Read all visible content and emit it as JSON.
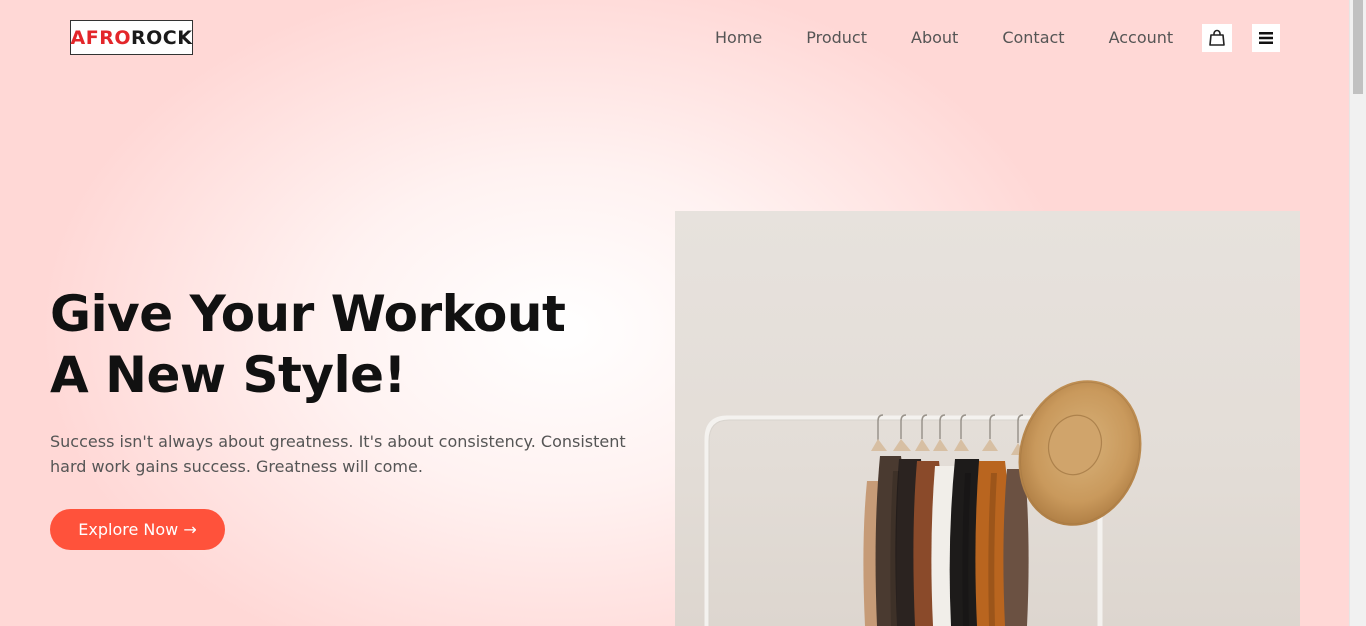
{
  "brand": {
    "logo_part1": "AFRO",
    "logo_part2": "ROCK",
    "accent_red": "#e3262a"
  },
  "nav": {
    "items": [
      {
        "label": "Home"
      },
      {
        "label": "Product"
      },
      {
        "label": "About"
      },
      {
        "label": "Contact"
      },
      {
        "label": "Account"
      }
    ],
    "cart_icon": "shopping-bag-icon",
    "menu_icon": "hamburger-menu-icon"
  },
  "hero": {
    "title_line1": "Give Your Workout",
    "title_line2": "A New Style!",
    "description": "Success isn't always about greatness. It's about consistency. Consistent hard work gains success. Greatness will come.",
    "cta_label": "Explore Now →",
    "cta_color": "#ff523b",
    "image_subject": "clothing-rack-with-hat"
  },
  "colors": {
    "background": "#ffd8d6",
    "text_dark": "#111111",
    "text_muted": "#555555"
  }
}
